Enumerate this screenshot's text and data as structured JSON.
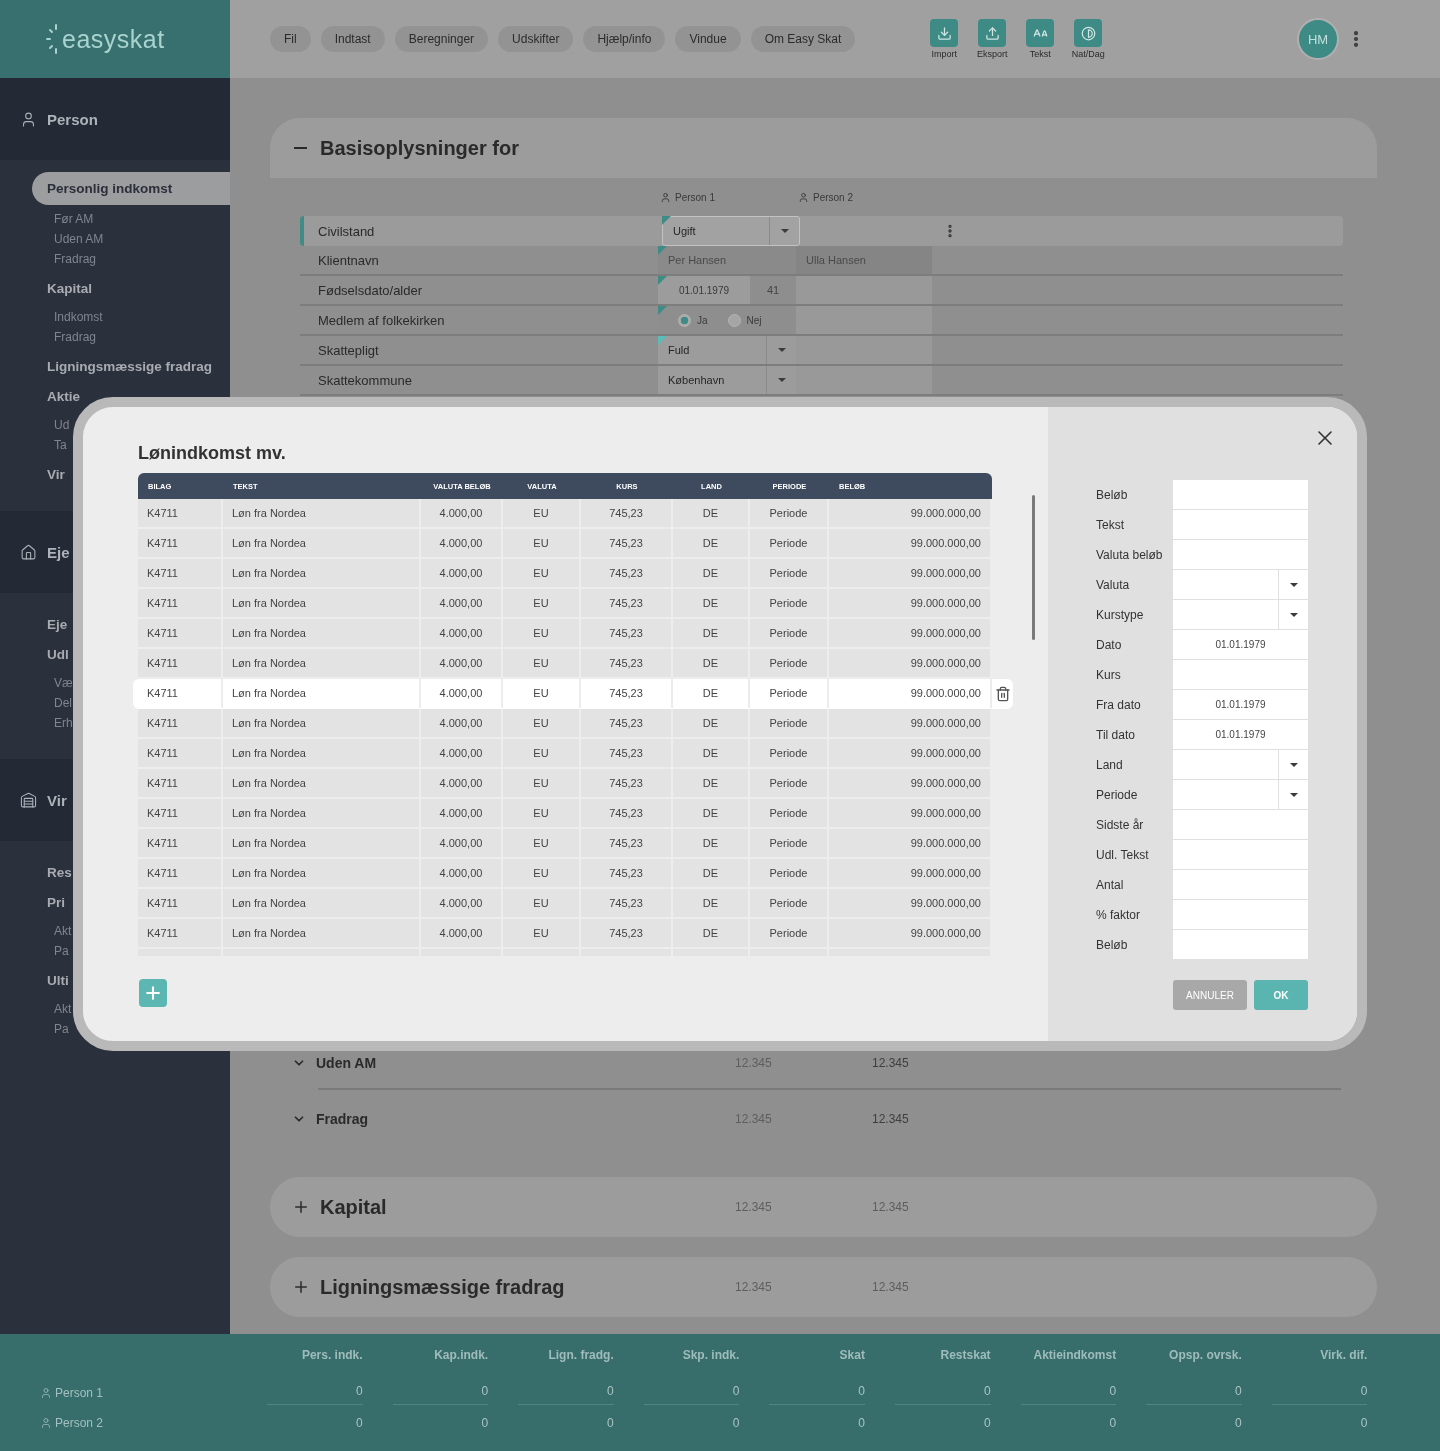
{
  "logo": "easyskat",
  "menu": [
    "Fil",
    "Indtast",
    "Beregninger",
    "Udskifter",
    "Hjælp/info",
    "Vindue",
    "Om Easy Skat"
  ],
  "tools": [
    {
      "label": "Import",
      "kind": "import"
    },
    {
      "label": "Eksport",
      "kind": "export"
    },
    {
      "label": "Tekst",
      "kind": "text"
    },
    {
      "label": "Nat/Dag",
      "kind": "theme"
    }
  ],
  "avatar": "HM",
  "sidebar": [
    {
      "title": "Person",
      "kind": "person",
      "groups": [
        {
          "title": "Personlig indkomst",
          "selected": true,
          "items": [
            "Før AM",
            "Uden AM",
            "Fradrag"
          ]
        },
        {
          "title": "Kapital",
          "selected": false,
          "items": [
            "Indkomst",
            "Fradrag"
          ]
        },
        {
          "title": "Ligningsmæssige fradrag",
          "selected": false
        },
        {
          "title": "Aktie",
          "selected": false,
          "items": [
            "Ud",
            "Ta"
          ]
        },
        {
          "title": "Vir",
          "selected": false
        }
      ]
    },
    {
      "title": "Eje",
      "kind": "house",
      "groups": [
        {
          "title": "Eje",
          "selected": false
        },
        {
          "title": "Udl",
          "selected": false,
          "items": [
            "Væ",
            "Del",
            "Erh"
          ]
        }
      ]
    },
    {
      "title": "Vir",
      "kind": "business",
      "groups": [
        {
          "title": "Res",
          "selected": false
        },
        {
          "title": "Pri",
          "selected": false,
          "items": [
            "Akt",
            "Pa"
          ]
        },
        {
          "title": "Ulti",
          "selected": false,
          "items": [
            "Akt",
            "Pa"
          ]
        }
      ]
    }
  ],
  "basis": {
    "title": "Basisoplysninger for",
    "expanded": true,
    "persons": [
      "Person 1",
      "Person 2"
    ],
    "rows": [
      {
        "label": "Civilstand",
        "selected": true,
        "kind": "select",
        "value": "Ugift",
        "color": "#3f8c87"
      },
      {
        "label": "Klientnavn",
        "selected": false,
        "kind": "text",
        "values": [
          "Per Hansen",
          "Ulla Hansen"
        ],
        "color": "#3f8c87"
      },
      {
        "label": "Fødselsdato/alder",
        "selected": false,
        "kind": "date",
        "value": "01.01.1979",
        "age": "41",
        "color": "#3f8c87"
      },
      {
        "label": "Medlem af folkekirken",
        "selected": false,
        "kind": "radio",
        "options": [
          {
            "label": "Ja",
            "selected": true
          },
          {
            "label": "Nej",
            "selected": false
          }
        ],
        "color": "#3f8c87"
      },
      {
        "label": "Skattepligt",
        "selected": false,
        "kind": "select",
        "value": "Fuld",
        "color": "#5cbcb7"
      },
      {
        "label": "Skattekommune",
        "selected": false,
        "kind": "select",
        "value": "København"
      }
    ]
  },
  "sections": [
    {
      "title": "Uden AM",
      "kind": "subrow",
      "expanded": false,
      "values": [
        "12.345",
        "12.345"
      ]
    },
    {
      "title": "Fradrag",
      "kind": "subrow",
      "expanded": false,
      "values": [
        "12.345",
        "12.345"
      ]
    },
    {
      "title": "Kapital",
      "kind": "card",
      "expanded": false,
      "values": [
        "12.345",
        "12.345"
      ]
    },
    {
      "title": "Ligningsmæssige fradrag",
      "kind": "card",
      "expanded": false,
      "values": [
        "12.345",
        "12.345"
      ]
    }
  ],
  "modal": {
    "title": "Lønindkomst mv.",
    "columns": [
      "BILAG",
      "TEKST",
      "VALUTA BELØB",
      "VALUTA",
      "KURS",
      "LAND",
      "PERIODE",
      "BELØB"
    ],
    "rows": [
      {
        "selected": false,
        "cells": [
          "K4711",
          "Løn fra Nordea",
          "4.000,00",
          "EU",
          "745,23",
          "DE",
          "Periode",
          "99.000.000,00"
        ]
      },
      {
        "selected": false,
        "cells": [
          "K4711",
          "Løn fra Nordea",
          "4.000,00",
          "EU",
          "745,23",
          "DE",
          "Periode",
          "99.000.000,00"
        ]
      },
      {
        "selected": false,
        "cells": [
          "K4711",
          "Løn fra Nordea",
          "4.000,00",
          "EU",
          "745,23",
          "DE",
          "Periode",
          "99.000.000,00"
        ]
      },
      {
        "selected": false,
        "cells": [
          "K4711",
          "Løn fra Nordea",
          "4.000,00",
          "EU",
          "745,23",
          "DE",
          "Periode",
          "99.000.000,00"
        ]
      },
      {
        "selected": false,
        "cells": [
          "K4711",
          "Løn fra Nordea",
          "4.000,00",
          "EU",
          "745,23",
          "DE",
          "Periode",
          "99.000.000,00"
        ]
      },
      {
        "selected": false,
        "cells": [
          "K4711",
          "Løn fra Nordea",
          "4.000,00",
          "EU",
          "745,23",
          "DE",
          "Periode",
          "99.000.000,00"
        ]
      },
      {
        "selected": true,
        "cells": [
          "K4711",
          "Løn fra Nordea",
          "4.000,00",
          "EU",
          "745,23",
          "DE",
          "Periode",
          "99.000.000,00"
        ]
      },
      {
        "selected": false,
        "cells": [
          "K4711",
          "Løn fra Nordea",
          "4.000,00",
          "EU",
          "745,23",
          "DE",
          "Periode",
          "99.000.000,00"
        ]
      },
      {
        "selected": false,
        "cells": [
          "K4711",
          "Løn fra Nordea",
          "4.000,00",
          "EU",
          "745,23",
          "DE",
          "Periode",
          "99.000.000,00"
        ]
      },
      {
        "selected": false,
        "cells": [
          "K4711",
          "Løn fra Nordea",
          "4.000,00",
          "EU",
          "745,23",
          "DE",
          "Periode",
          "99.000.000,00"
        ]
      },
      {
        "selected": false,
        "cells": [
          "K4711",
          "Løn fra Nordea",
          "4.000,00",
          "EU",
          "745,23",
          "DE",
          "Periode",
          "99.000.000,00"
        ]
      },
      {
        "selected": false,
        "cells": [
          "K4711",
          "Løn fra Nordea",
          "4.000,00",
          "EU",
          "745,23",
          "DE",
          "Periode",
          "99.000.000,00"
        ]
      },
      {
        "selected": false,
        "cells": [
          "K4711",
          "Løn fra Nordea",
          "4.000,00",
          "EU",
          "745,23",
          "DE",
          "Periode",
          "99.000.000,00"
        ]
      },
      {
        "selected": false,
        "cells": [
          "K4711",
          "Løn fra Nordea",
          "4.000,00",
          "EU",
          "745,23",
          "DE",
          "Periode",
          "99.000.000,00"
        ]
      },
      {
        "selected": false,
        "cells": [
          "K4711",
          "Løn fra Nordea",
          "4.000,00",
          "EU",
          "745,23",
          "DE",
          "Periode",
          "99.000.000,00"
        ]
      }
    ],
    "fields": [
      {
        "label": "Beløb",
        "kind": "text"
      },
      {
        "label": "Tekst",
        "kind": "text"
      },
      {
        "label": "Valuta beløb",
        "kind": "text"
      },
      {
        "label": "Valuta",
        "kind": "select"
      },
      {
        "label": "Kurstype",
        "kind": "select"
      },
      {
        "label": "Dato",
        "kind": "date",
        "value": "01.01.1979"
      },
      {
        "label": "Kurs",
        "kind": "text"
      },
      {
        "label": "Fra dato",
        "kind": "date",
        "value": "01.01.1979"
      },
      {
        "label": "Til dato",
        "kind": "date",
        "value": "01.01.1979"
      },
      {
        "label": "Land",
        "kind": "select"
      },
      {
        "label": "Periode",
        "kind": "select"
      },
      {
        "label": "Sidste år",
        "kind": "text"
      },
      {
        "label": "Udl. Tekst",
        "kind": "text"
      },
      {
        "label": "Antal",
        "kind": "text"
      },
      {
        "label": "% faktor",
        "kind": "text"
      },
      {
        "label": "Beløb",
        "kind": "text"
      }
    ],
    "buttons": [
      {
        "label": "ANNULER",
        "kind": "secondary"
      },
      {
        "label": "OK",
        "kind": "primary"
      }
    ]
  },
  "summary": {
    "columns": [
      "Pers. indk.",
      "Kap.indk.",
      "Lign. fradg.",
      "Skp. indk.",
      "Skat",
      "Restskat",
      "Aktieindkomst",
      "Opsp. ovrsk.",
      "Virk. dif."
    ],
    "rows": [
      {
        "label": "Person 1",
        "values": [
          "0",
          "0",
          "0",
          "0",
          "0",
          "0",
          "0",
          "0",
          "0"
        ]
      },
      {
        "label": "Person 2",
        "values": [
          "0",
          "0",
          "0",
          "0",
          "0",
          "0",
          "0",
          "0",
          "0"
        ]
      }
    ]
  }
}
